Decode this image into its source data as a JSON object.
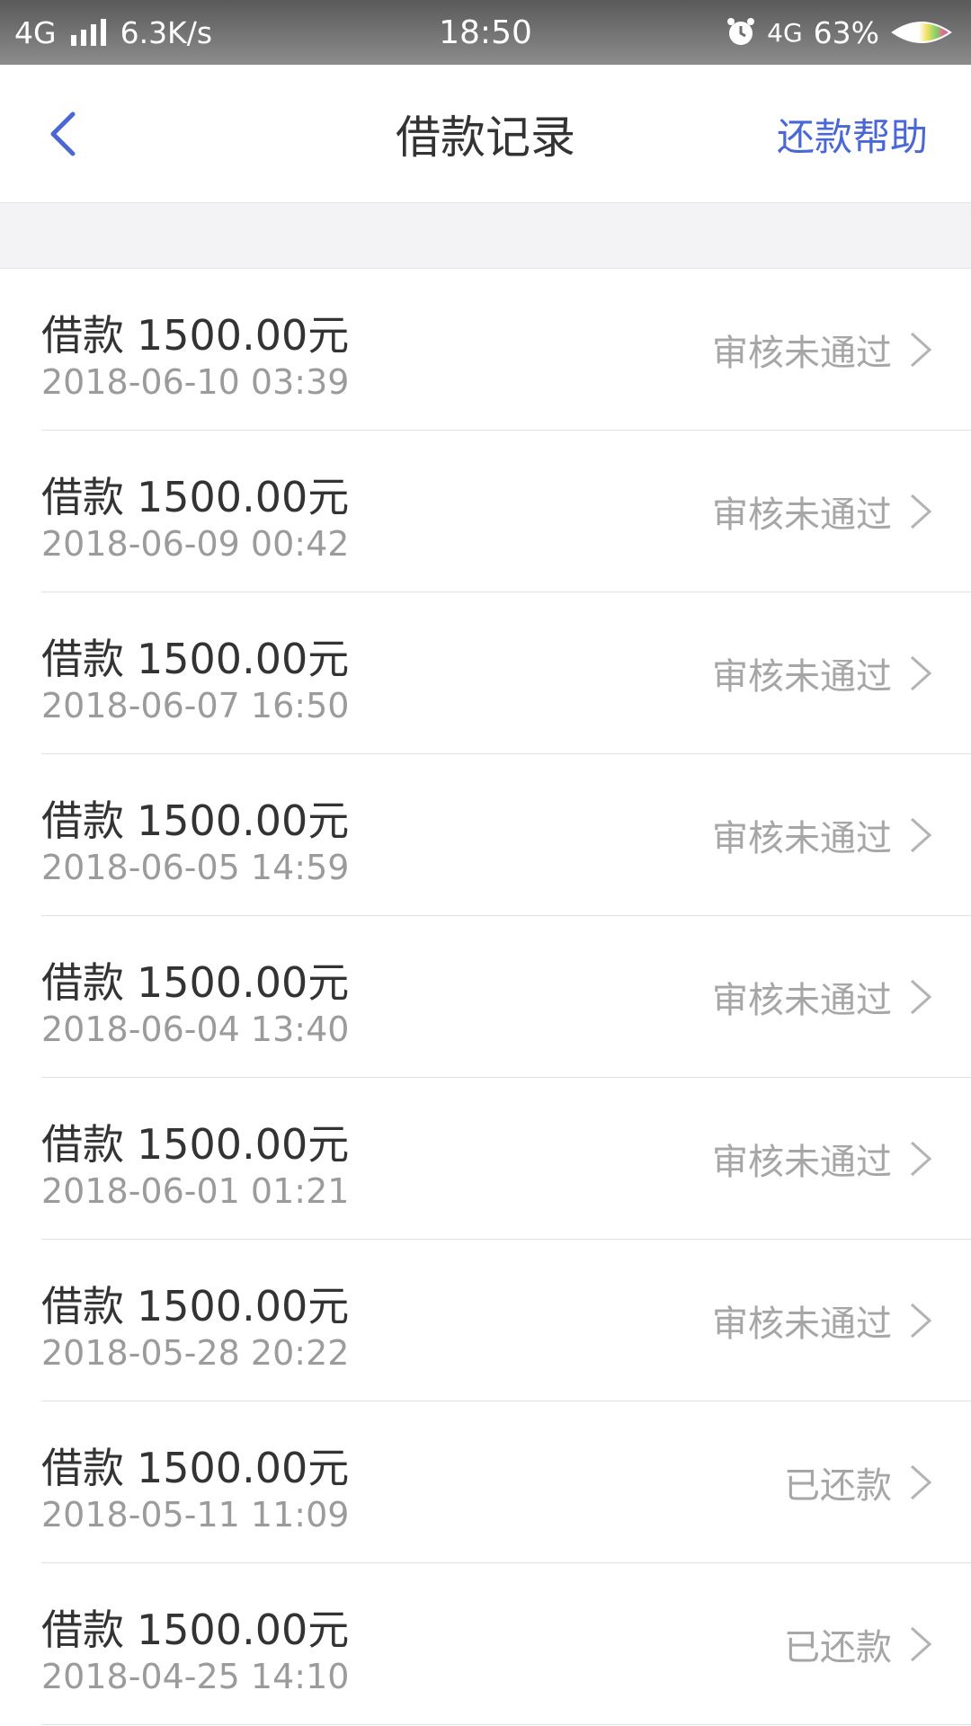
{
  "status_bar": {
    "network": "4G",
    "speed": "6.3K/s",
    "time": "18:50",
    "network_right": "4G",
    "battery": "63%"
  },
  "header": {
    "title": "借款记录",
    "help_label": "还款帮助"
  },
  "colors": {
    "accent": "#4a67d6",
    "text_primary": "#333333",
    "text_secondary": "#9b9b9b"
  },
  "records": [
    {
      "prefix": "借款",
      "amount": "1500.00元",
      "date": "2018-06-10 03:39",
      "status": "审核未通过"
    },
    {
      "prefix": "借款",
      "amount": "1500.00元",
      "date": "2018-06-09 00:42",
      "status": "审核未通过"
    },
    {
      "prefix": "借款",
      "amount": "1500.00元",
      "date": "2018-06-07 16:50",
      "status": "审核未通过"
    },
    {
      "prefix": "借款",
      "amount": "1500.00元",
      "date": "2018-06-05 14:59",
      "status": "审核未通过"
    },
    {
      "prefix": "借款",
      "amount": "1500.00元",
      "date": "2018-06-04 13:40",
      "status": "审核未通过"
    },
    {
      "prefix": "借款",
      "amount": "1500.00元",
      "date": "2018-06-01 01:21",
      "status": "审核未通过"
    },
    {
      "prefix": "借款",
      "amount": "1500.00元",
      "date": "2018-05-28 20:22",
      "status": "审核未通过"
    },
    {
      "prefix": "借款",
      "amount": "1500.00元",
      "date": "2018-05-11 11:09",
      "status": "已还款"
    },
    {
      "prefix": "借款",
      "amount": "1500.00元",
      "date": "2018-04-25 14:10",
      "status": "已还款"
    }
  ]
}
